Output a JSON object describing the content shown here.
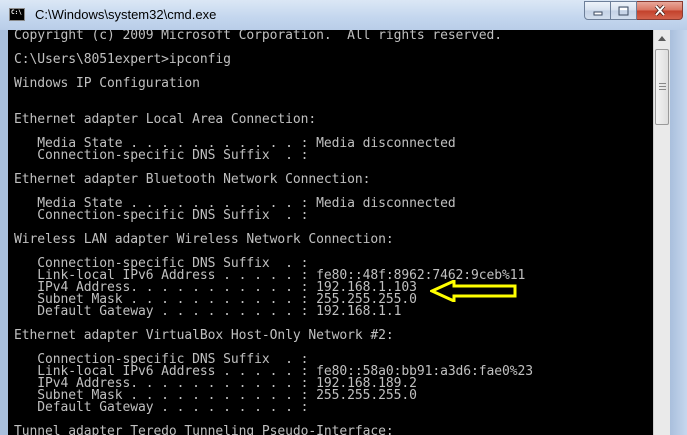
{
  "window": {
    "title": "C:\\Windows\\system32\\cmd.exe",
    "icon_glyph": "C:\\"
  },
  "console": {
    "lines": [
      "Copyright (c) 2009 Microsoft Corporation.  All rights reserved.",
      "",
      "C:\\Users\\8051expert>ipconfig",
      "",
      "Windows IP Configuration",
      "",
      "",
      "Ethernet adapter Local Area Connection:",
      "",
      "   Media State . . . . . . . . . . . : Media disconnected",
      "   Connection-specific DNS Suffix  . :",
      "",
      "Ethernet adapter Bluetooth Network Connection:",
      "",
      "   Media State . . . . . . . . . . . : Media disconnected",
      "   Connection-specific DNS Suffix  . :",
      "",
      "Wireless LAN adapter Wireless Network Connection:",
      "",
      "   Connection-specific DNS Suffix  . :",
      "   Link-local IPv6 Address . . . . . : fe80::48f:8962:7462:9ceb%11",
      "   IPv4 Address. . . . . . . . . . . : 192.168.1.103",
      "   Subnet Mask . . . . . . . . . . . : 255.255.255.0",
      "   Default Gateway . . . . . . . . . : 192.168.1.1",
      "",
      "Ethernet adapter VirtualBox Host-Only Network #2:",
      "",
      "   Connection-specific DNS Suffix  . :",
      "   Link-local IPv6 Address . . . . . : fe80::58a0:bb91:a3d6:fae0%23",
      "   IPv4 Address. . . . . . . . . . . : 192.168.189.2",
      "   Subnet Mask . . . . . . . . . . . : 255.255.255.0",
      "   Default Gateway . . . . . . . . . :",
      "",
      "Tunnel adapter Teredo Tunneling Pseudo-Interface:"
    ]
  },
  "annotation": {
    "icon": "left-arrow-icon",
    "color": "#ffff00"
  },
  "colors": {
    "console_bg": "#000000",
    "console_text": "#c0c0c0"
  }
}
